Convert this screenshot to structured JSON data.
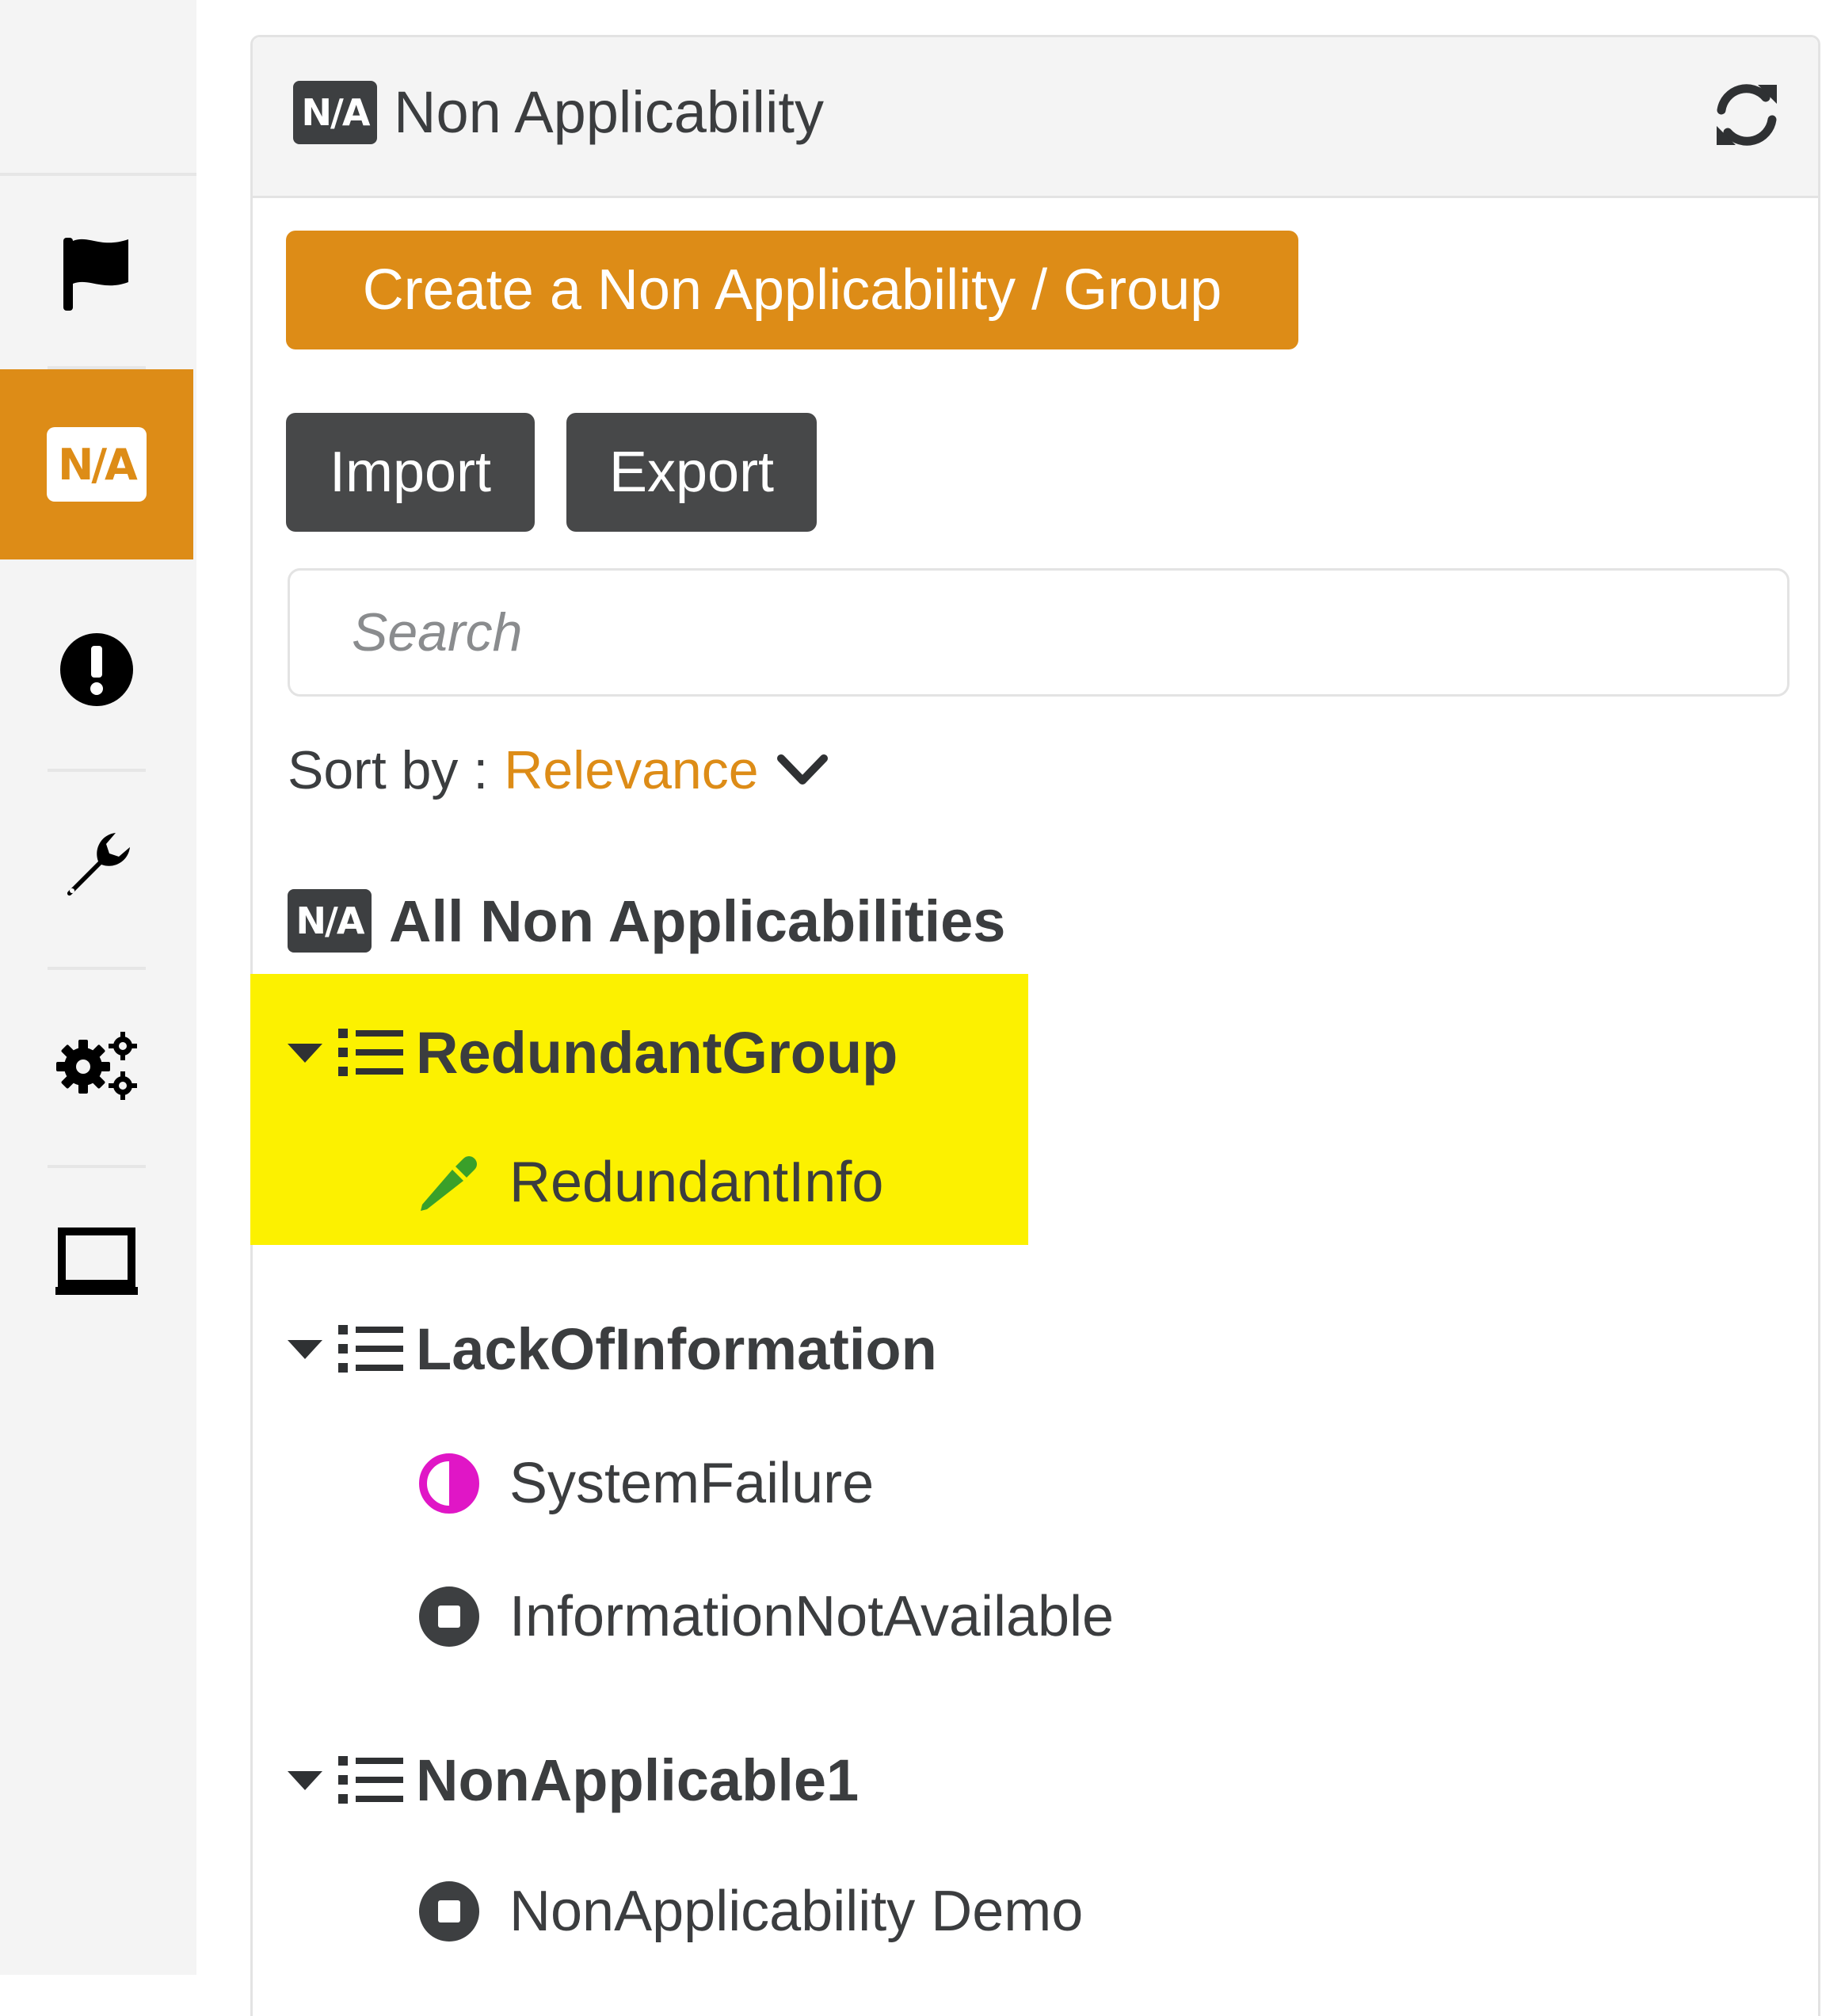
{
  "sidebar": {
    "items": [
      {
        "icon": "flag-icon",
        "active": false
      },
      {
        "icon": "na-icon",
        "label": "N/A",
        "active": true
      },
      {
        "icon": "exclamation-circle-icon",
        "active": false
      },
      {
        "icon": "wrench-icon",
        "active": false
      },
      {
        "icon": "gears-icon",
        "active": false
      },
      {
        "icon": "laptop-icon",
        "active": false
      }
    ]
  },
  "panel": {
    "header": {
      "badge": "N/A",
      "title": "Non Applicability",
      "refresh_icon": "refresh-icon"
    },
    "create_label": "Create a Non Applicability / Group",
    "import_label": "Import",
    "export_label": "Export",
    "search_placeholder": "Search",
    "sort": {
      "label": "Sort by :",
      "value": "Relevance"
    },
    "all": {
      "badge": "N/A",
      "label": "All Non Applicabilities"
    },
    "groups": [
      {
        "label": "RedundantGroup",
        "highlighted": true,
        "items": [
          {
            "label": "RedundantInfo",
            "icon": "pencil-icon",
            "icon_color": "#3aa02a"
          }
        ]
      },
      {
        "label": "LackOfInformation",
        "highlighted": false,
        "items": [
          {
            "label": "SystemFailure",
            "icon": "half-circle-icon",
            "icon_color": "#e016c6"
          },
          {
            "label": "InformationNotAvailable",
            "icon": "stop-circle-icon",
            "icon_color": "#3d3f41"
          }
        ]
      },
      {
        "label": "NonApplicable1",
        "highlighted": false,
        "items": [
          {
            "label": "NonApplicability Demo",
            "icon": "stop-circle-icon",
            "icon_color": "#3d3f41"
          }
        ]
      }
    ]
  },
  "colors": {
    "accent": "#dd8c17",
    "dark_button": "#474849",
    "highlight": "#fcf100",
    "text": "#3b3d3f"
  }
}
